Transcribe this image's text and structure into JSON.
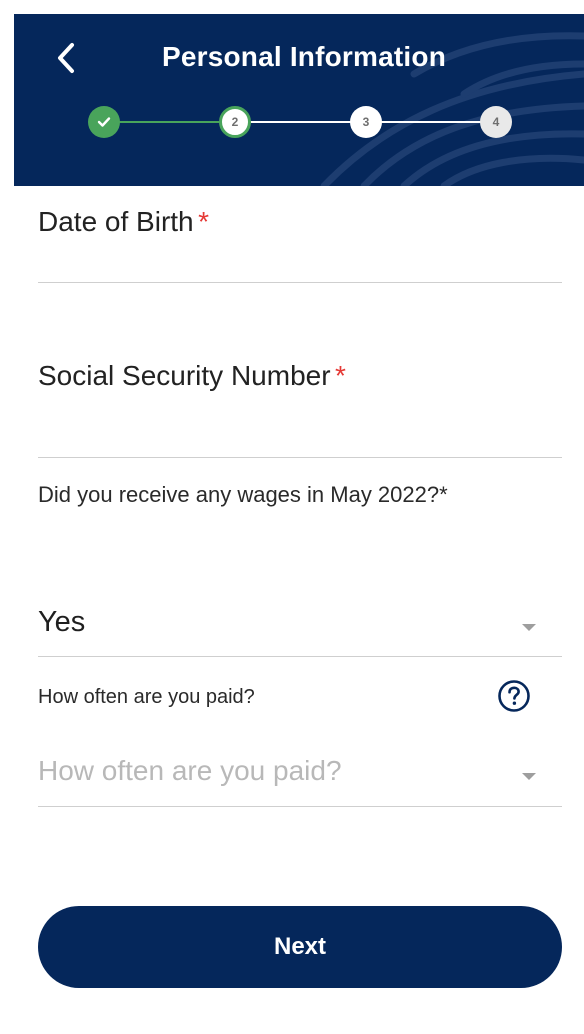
{
  "header": {
    "title": "Personal Information",
    "back_icon": "chevron-left-icon",
    "steps": [
      {
        "label": "",
        "state": "complete",
        "icon": "check-icon"
      },
      {
        "label": "2",
        "state": "current"
      },
      {
        "label": "3",
        "state": "upcoming"
      },
      {
        "label": "4",
        "state": "upcoming"
      }
    ],
    "colors": {
      "bar": "#05275b",
      "progress": "#49a45b"
    }
  },
  "form": {
    "dob": {
      "label": "Date of Birth",
      "required_mark": "*"
    },
    "ssn": {
      "label": "Social Security Number",
      "required_mark": "*"
    },
    "wages": {
      "question": "Did you receive any wages in May 2022?",
      "required_mark": "*",
      "value": "Yes"
    },
    "pay_frequency": {
      "label": "How often are you paid?",
      "placeholder": "How often are you paid?",
      "help_icon": "question-circle-icon"
    }
  },
  "actions": {
    "next_label": "Next"
  }
}
